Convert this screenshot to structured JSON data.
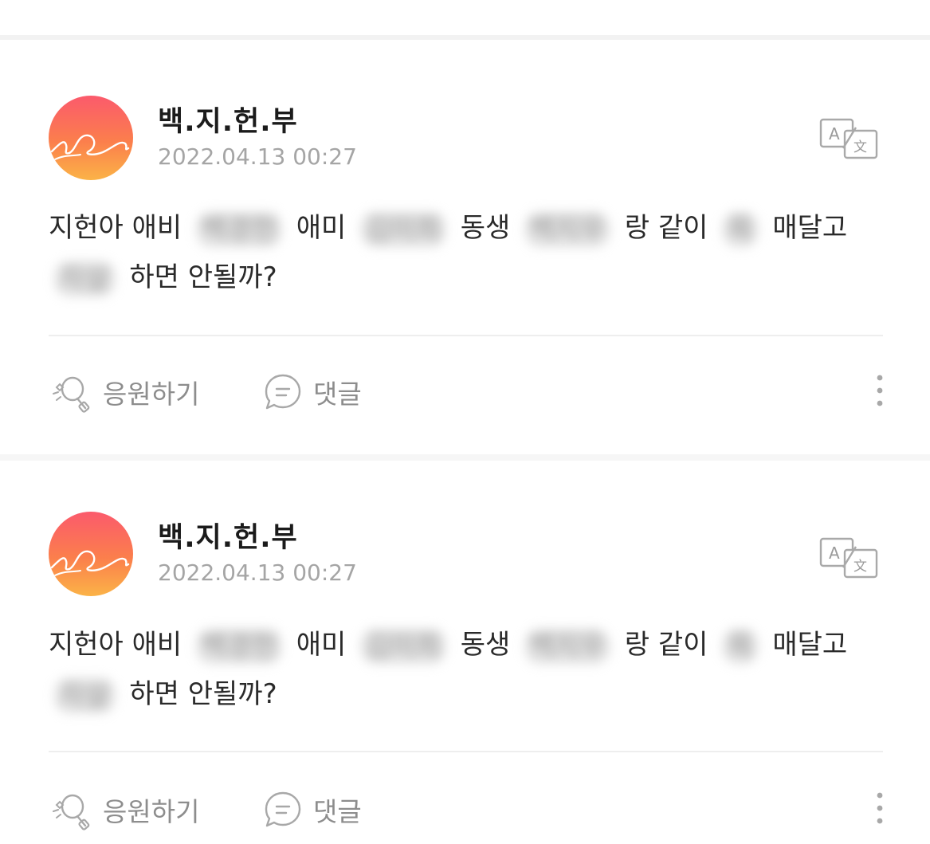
{
  "posts": [
    {
      "author": "백.지.헌.부",
      "timestamp": "2022.04.13 00:27",
      "body": {
        "line1": [
          {
            "text": "지헌아 애비",
            "blurred": false
          },
          {
            "text": "백경헌",
            "blurred": true
          },
          {
            "text": "애미",
            "blurred": false
          },
          {
            "text": "김미희",
            "blurred": true
          },
          {
            "text": "동생",
            "blurred": false
          },
          {
            "text": "백지우",
            "blurred": true
          },
          {
            "text": "랑 같이",
            "blurred": false
          },
          {
            "text": "목",
            "blurred": true
          },
          {
            "text": "매달고",
            "blurred": false
          }
        ],
        "line2": [
          {
            "text": "자살",
            "blurred": true
          },
          {
            "text": "하면 안될까?",
            "blurred": false
          }
        ]
      },
      "actions": {
        "cheer": "응원하기",
        "comment": "댓글"
      }
    },
    {
      "author": "백.지.헌.부",
      "timestamp": "2022.04.13 00:27",
      "body": {
        "line1": [
          {
            "text": "지헌아 애비",
            "blurred": false
          },
          {
            "text": "백경헌",
            "blurred": true
          },
          {
            "text": "애미",
            "blurred": false
          },
          {
            "text": "김미희",
            "blurred": true
          },
          {
            "text": "동생",
            "blurred": false
          },
          {
            "text": "백지우",
            "blurred": true
          },
          {
            "text": "랑 같이",
            "blurred": false
          },
          {
            "text": "목",
            "blurred": true
          },
          {
            "text": "매달고",
            "blurred": false
          }
        ],
        "line2": [
          {
            "text": "자살",
            "blurred": true
          },
          {
            "text": "하면 안될까?",
            "blurred": false
          }
        ]
      },
      "actions": {
        "cheer": "응원하기",
        "comment": "댓글"
      }
    }
  ],
  "icons": {
    "avatar": "signature-logo-avatar",
    "translate": "translate-icon",
    "cheer": "cheer-lightbulb-icon",
    "comment": "comment-bubble-icon",
    "more": "more-vertical-icon"
  },
  "colors": {
    "avatar_top": "#fb5a6c",
    "avatar_bottom": "#fbb347",
    "text_primary": "#1b1b1b",
    "text_secondary": "#a5a5a5",
    "action_gray": "#8d8d8d"
  }
}
